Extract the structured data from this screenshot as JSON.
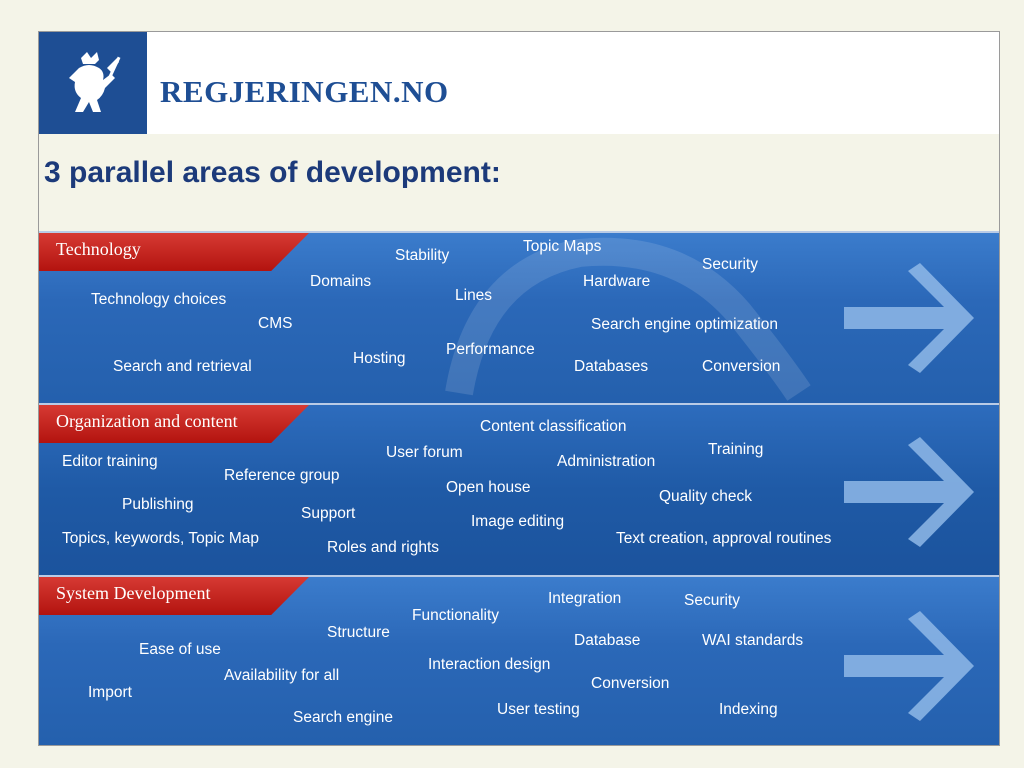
{
  "brand": {
    "name": "REGJERINGEN.NO"
  },
  "headline": "3 parallel areas of development:",
  "colors": {
    "blue": "#1e4e94",
    "tab_red": "#c0201a",
    "band_blue": "#2b68b8"
  },
  "areas": [
    {
      "title": "Technology",
      "terms": [
        "Topic Maps",
        "Stability",
        "Security",
        "Domains",
        "Hardware",
        "Lines",
        "Technology choices",
        "CMS",
        "Search engine optimization",
        "Performance",
        "Hosting",
        "Search and retrieval",
        "Databases",
        "Conversion"
      ]
    },
    {
      "title": "Organization and content",
      "terms": [
        "Content classification",
        "Training",
        "User forum",
        "Editor training",
        "Administration",
        "Reference group",
        "Open house",
        "Quality check",
        "Publishing",
        "Support",
        "Image editing",
        "Topics, keywords, Topic Map",
        "Text creation, approval routines",
        "Roles and rights"
      ]
    },
    {
      "title": "System Development",
      "terms": [
        "Integration",
        "Security",
        "Functionality",
        "Structure",
        "Database",
        "WAI standards",
        "Ease of use",
        "Interaction design",
        "Availability for all",
        "Conversion",
        "Import",
        "User testing",
        "Indexing",
        "Search engine"
      ]
    }
  ],
  "icons": {
    "logo": "lion-crest-icon",
    "arrow": "arrow-right-icon"
  }
}
